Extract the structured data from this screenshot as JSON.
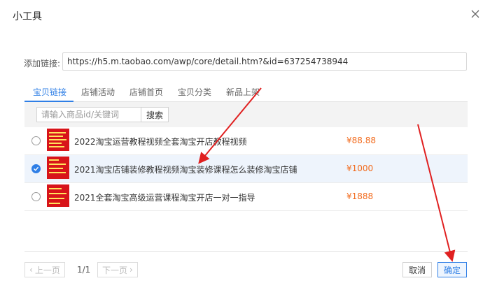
{
  "dialog": {
    "title": "小工具"
  },
  "link": {
    "label": "添加链接:",
    "value": "https://h5.m.taobao.com/awp/core/detail.htm?&id=637254738944"
  },
  "tabs": [
    {
      "label": "宝贝链接",
      "active": true
    },
    {
      "label": "店铺活动",
      "active": false
    },
    {
      "label": "店铺首页",
      "active": false
    },
    {
      "label": "宝贝分类",
      "active": false
    },
    {
      "label": "新品上架",
      "active": false
    }
  ],
  "search": {
    "placeholder": "请输入商品id/关键词",
    "button_label": "搜索"
  },
  "products": [
    {
      "title": "2022淘宝运营教程视频全套淘宝开店教程视频",
      "price": "¥88.88",
      "selected": false
    },
    {
      "title": "2021淘宝店铺装修教程视频淘宝装修课程怎么装修淘宝店铺",
      "price": "¥1000",
      "selected": true
    },
    {
      "title": "2021全套淘宝高级运营课程淘宝开店一对一指导",
      "price": "¥1888",
      "selected": false
    }
  ],
  "pagination": {
    "prev_label": "上一页",
    "next_label": "下一页",
    "page_info": "1/1"
  },
  "footer": {
    "cancel_label": "取消",
    "confirm_label": "确定"
  },
  "colors": {
    "accent": "#2f7fe6",
    "price": "#f26b1d",
    "annotation_arrow": "#e02020",
    "thumbnail": "#d8141a"
  }
}
